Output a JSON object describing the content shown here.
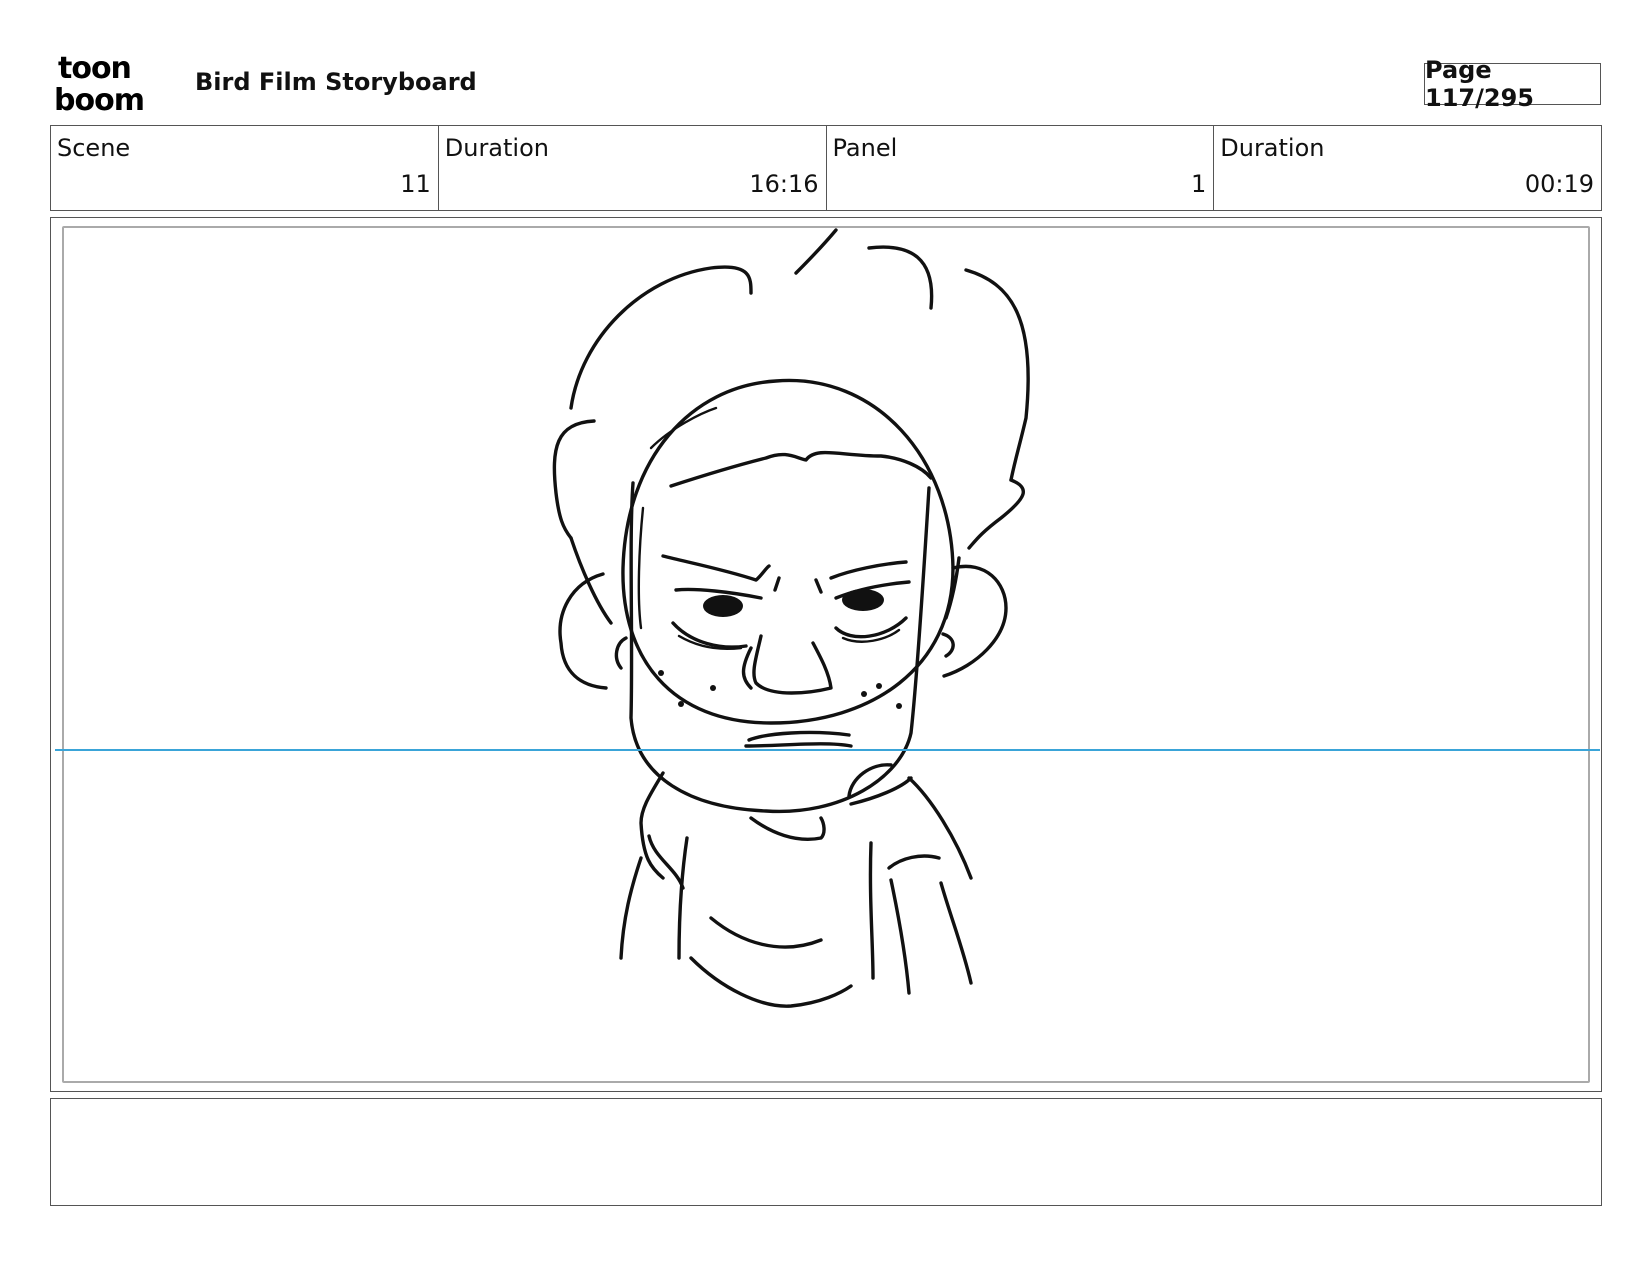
{
  "header": {
    "logo_icon": "toonboom-logo-icon",
    "logo_text_top": "toon",
    "logo_text_bottom": "boom",
    "title": "Bird Film Storyboard",
    "page_label": "Page 117/295"
  },
  "info": [
    {
      "label": "Scene",
      "value": "11"
    },
    {
      "label": "Duration",
      "value": "16:16"
    },
    {
      "label": "Panel",
      "value": "1"
    },
    {
      "label": "Duration",
      "value": "00:19"
    }
  ],
  "panel": {
    "image": "character-sketch",
    "horizon_color": "#3aa4d8"
  },
  "notes": {
    "text": ""
  }
}
